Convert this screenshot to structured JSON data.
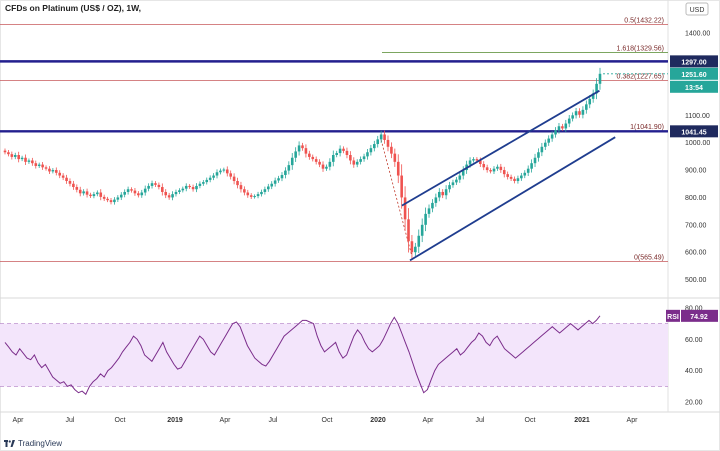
{
  "app": {
    "brand": "TradingView"
  },
  "chart_data": {
    "type": "candlestick",
    "title": "CFDs on Platinum (US$ / OZ), 1W,",
    "currency_badge": "USD",
    "price_axis": {
      "range": [
        440,
        1470
      ],
      "ticks": [
        500,
        600,
        700,
        800,
        900,
        1000,
        1100,
        1200,
        1300,
        1400
      ],
      "scale": "linear"
    },
    "time_axis": {
      "labels": [
        "Apr",
        "Jul",
        "Oct",
        "2019",
        "Apr",
        "Jul",
        "Oct",
        "2020",
        "Apr",
        "Jul",
        "Oct",
        "2021",
        "Apr"
      ],
      "emphasized": [
        "2019",
        "2020",
        "2021"
      ]
    },
    "fibonacci_levels": [
      {
        "label": "0.5(1432.22)",
        "price": 1432.22
      },
      {
        "label": "1.618(1329.56)",
        "price": 1329.56
      },
      {
        "label": "0.382(1227.65)",
        "price": 1227.65
      },
      {
        "label": "1(1041.90)",
        "price": 1041.9
      },
      {
        "label": "0(565.49)",
        "price": 565.49
      }
    ],
    "horizontal_lines": [
      {
        "price_tag": "1297.00",
        "price": 1297.0
      },
      {
        "price_tag": "1041.45",
        "price": 1041.45
      }
    ],
    "current": {
      "price_tag": "1251.60",
      "countdown": "13:54",
      "price": 1251.6
    },
    "channel": {
      "upper": [
        {
          "date": "2020-03-01",
          "price": 770
        },
        {
          "date": "2021-02-28",
          "price": 1190
        }
      ],
      "lower": [
        {
          "date": "2020-03-16",
          "price": 570
        },
        {
          "date": "2021-03-29",
          "price": 1020
        }
      ]
    },
    "series": [
      {
        "values": [
          965,
          958,
          948,
          955,
          940,
          945,
          930,
          935,
          925,
          915,
          920,
          910,
          905,
          895,
          900,
          890,
          880,
          872,
          860,
          850,
          838,
          828,
          815,
          822,
          810,
          805,
          812,
          818,
          802,
          795,
          790,
          783,
          792,
          800,
          810,
          820,
          830,
          825,
          815,
          808,
          818,
          832,
          842,
          852,
          846,
          838,
          820,
          808,
          800,
          812,
          820,
          826,
          832,
          842,
          838,
          830,
          842,
          850,
          856,
          864,
          872,
          880,
          892,
          898,
          902,
          888,
          876,
          860,
          845,
          830,
          818,
          808,
          802,
          805,
          812,
          820,
          830,
          840,
          850,
          862,
          870,
          882,
          898,
          918,
          945,
          968,
          990,
          980,
          960,
          948,
          940,
          930,
          920,
          905,
          912,
          930,
          955,
          962,
          978,
          970,
          955,
          935,
          920,
          930,
          940,
          950,
          965,
          980,
          995,
          1012,
          1030,
          1010,
          985,
          960,
          930,
          880,
          800,
          720,
          640,
          600,
          620,
          660,
          700,
          740,
          760,
          780,
          800,
          820,
          808,
          830,
          845,
          855,
          865,
          880,
          900,
          920,
          935,
          940,
          935,
          922,
          910,
          900,
          895,
          905,
          912,
          900,
          885,
          875,
          868,
          860,
          870,
          880,
          890,
          905,
          925,
          945,
          965,
          985,
          1000,
          1015,
          1030,
          1045,
          1060,
          1052,
          1070,
          1088,
          1100,
          1115,
          1102,
          1120,
          1140,
          1160,
          1180,
          1215,
          1251.6
        ]
      }
    ],
    "rsi": {
      "label": "RSI",
      "value": "74.92",
      "current": 74.92,
      "ticks": [
        20,
        40,
        60,
        80
      ],
      "band": [
        30,
        70
      ],
      "range": [
        15,
        85
      ],
      "values": [
        58,
        55,
        52,
        50,
        54,
        51,
        48,
        47,
        50,
        45,
        42,
        44,
        40,
        36,
        34,
        32,
        33,
        30,
        31,
        28,
        26,
        27,
        25,
        30,
        33,
        35,
        38,
        36,
        40,
        42,
        45,
        48,
        52,
        55,
        58,
        62,
        60,
        56,
        50,
        48,
        46,
        50,
        54,
        58,
        52,
        48,
        44,
        41,
        42,
        46,
        50,
        54,
        58,
        62,
        60,
        56,
        52,
        50,
        54,
        58,
        62,
        66,
        70,
        71,
        68,
        62,
        56,
        52,
        48,
        46,
        44,
        43,
        46,
        50,
        54,
        58,
        62,
        64,
        66,
        68,
        70,
        72,
        72,
        71,
        70,
        62,
        56,
        52,
        54,
        56,
        58,
        52,
        48,
        50,
        56,
        62,
        66,
        63,
        58,
        54,
        52,
        54,
        56,
        60,
        65,
        70,
        74,
        70,
        64,
        58,
        52,
        45,
        38,
        32,
        26,
        28,
        34,
        40,
        44,
        46,
        48,
        50,
        52,
        54,
        50,
        52,
        55,
        58,
        60,
        64,
        62,
        58,
        56,
        60,
        62,
        58,
        54,
        52,
        50,
        48,
        50,
        52,
        54,
        56,
        58,
        60,
        62,
        64,
        66,
        68,
        66,
        64,
        66,
        68,
        70,
        68,
        66,
        68,
        70,
        72,
        70,
        72,
        74.92
      ]
    }
  }
}
